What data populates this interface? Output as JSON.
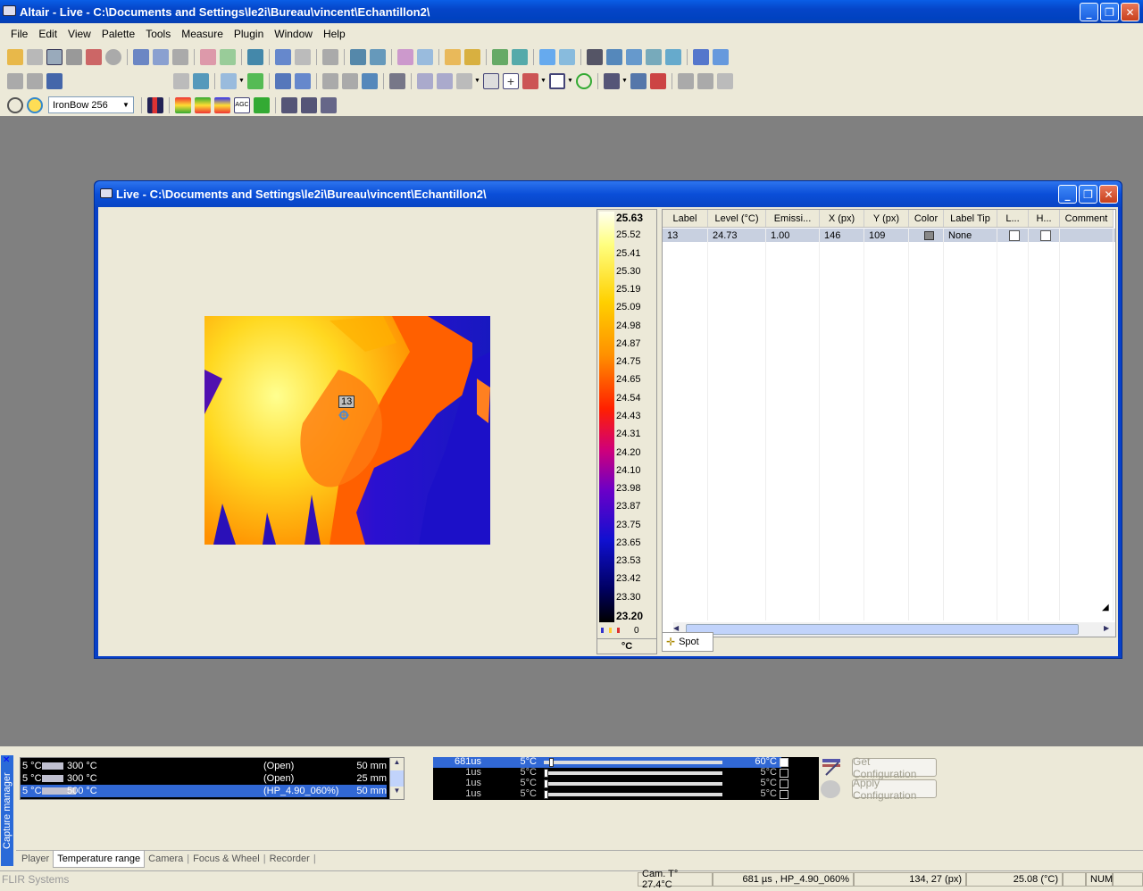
{
  "app": {
    "title": "Altair - Live - C:\\Documents and Settings\\le2i\\Bureau\\vincent\\Echantillon2\\"
  },
  "menu": [
    "File",
    "Edit",
    "View",
    "Palette",
    "Tools",
    "Measure",
    "Plugin",
    "Window",
    "Help"
  ],
  "palette": {
    "selected": "IronBow 256"
  },
  "child": {
    "title": "Live - C:\\Documents and Settings\\le2i\\Bureau\\vincent\\Echantillon2\\"
  },
  "spot_marker": "13",
  "scale": {
    "ticks": [
      "25.63",
      "25.52",
      "25.41",
      "25.30",
      "25.19",
      "25.09",
      "24.98",
      "24.87",
      "24.75",
      "24.65",
      "24.54",
      "24.43",
      "24.31",
      "24.20",
      "24.10",
      "23.98",
      "23.87",
      "23.75",
      "23.65",
      "23.53",
      "23.42",
      "23.30",
      "23.20"
    ],
    "count": "0",
    "unit": "°C"
  },
  "table": {
    "columns": [
      "Label",
      "Level (°C)",
      "Emissi...",
      "X (px)",
      "Y (px)",
      "Color",
      "Label Tip",
      "L...",
      "H...",
      "Comment"
    ],
    "row": [
      "13",
      "24.73",
      "1.00",
      "146",
      "109",
      "",
      "None",
      "",
      "",
      ""
    ],
    "tab": "Spot"
  },
  "lens": [
    {
      "c1": "5 °C",
      "c2": "300 °C",
      "filter": "(Open)",
      "focal": "50 mm"
    },
    {
      "c1": "5 °C",
      "c2": "300 °C",
      "filter": "(Open)",
      "focal": "25 mm"
    },
    {
      "c1": "5 °C",
      "c2": "500 °C",
      "filter": "(HP_4.90_060%)",
      "focal": "50 mm"
    }
  ],
  "integration": [
    {
      "time": "681us",
      "min": "5°C",
      "max": "60°C"
    },
    {
      "time": "1us",
      "min": "5°C",
      "max": "5°C"
    },
    {
      "time": "1us",
      "min": "5°C",
      "max": "5°C"
    },
    {
      "time": "1us",
      "min": "5°C",
      "max": "5°C"
    }
  ],
  "buttons": {
    "get": "Get Configuration",
    "apply": "Apply Configuration"
  },
  "capture_manager": "Capture manager",
  "tabs": [
    "Player",
    "Temperature range",
    "Camera",
    "Focus & Wheel",
    "Recorder"
  ],
  "status": {
    "brand": "FLIR Systems",
    "cam": "Cam. T° 27.4°C",
    "integration": "681 µs , HP_4.90_060%",
    "pos": "134,  27 (px)",
    "temp": "25.08 (°C)",
    "num": "NUM"
  }
}
